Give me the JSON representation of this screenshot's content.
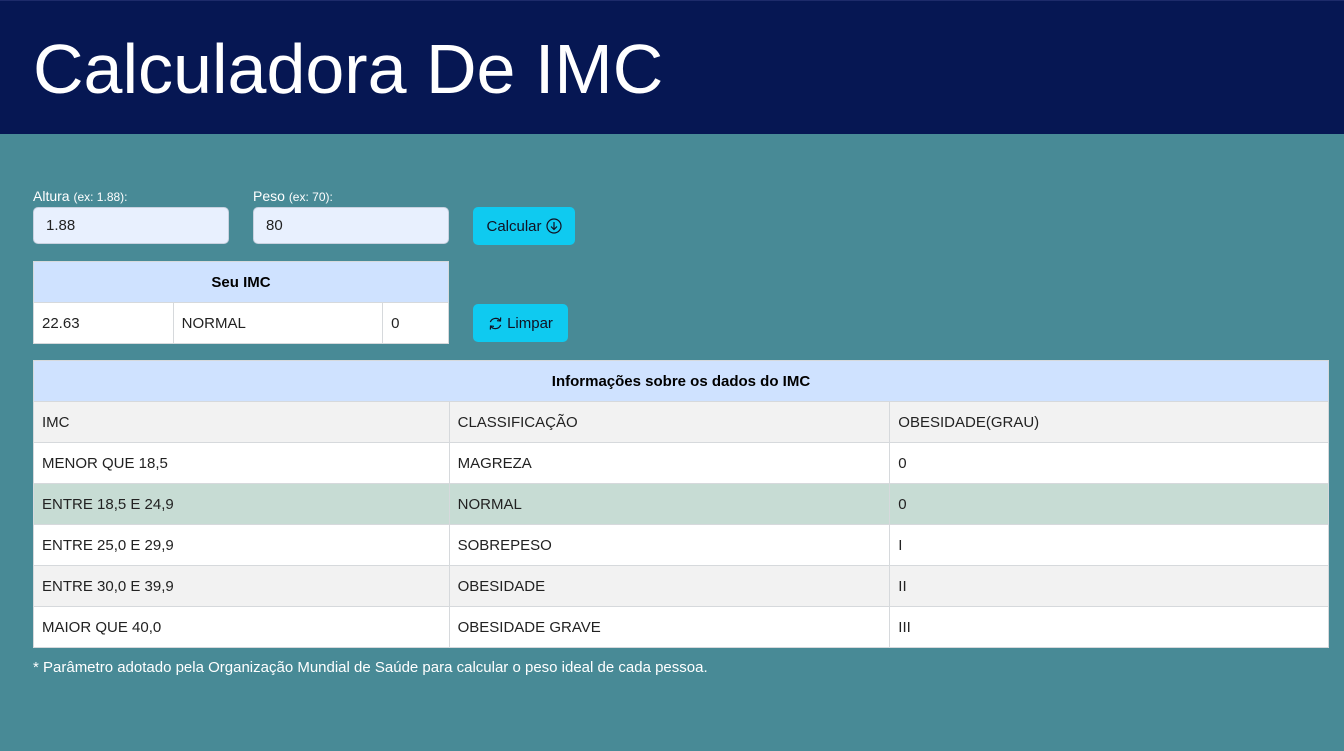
{
  "header": {
    "title": "Calculadora De IMC"
  },
  "form": {
    "altura": {
      "label": "Altura",
      "hint": "(ex: 1.88):",
      "value": "1.88"
    },
    "peso": {
      "label": "Peso",
      "hint": "(ex: 70):",
      "value": "80"
    },
    "calcular_label": "Calcular",
    "limpar_label": "Limpar"
  },
  "result": {
    "title": "Seu IMC",
    "imc": "22.63",
    "classificacao": "NORMAL",
    "grau": "0"
  },
  "info_table": {
    "title": "Informações sobre os dados do IMC",
    "headers": [
      "IMC",
      "CLASSIFICAÇÃO",
      "OBESIDADE(GRAU)"
    ],
    "rows": [
      [
        "MENOR QUE 18,5",
        "MAGREZA",
        "0"
      ],
      [
        "ENTRE 18,5 E 24,9",
        "NORMAL",
        "0"
      ],
      [
        "ENTRE 25,0 E 29,9",
        "SOBREPESO",
        "I"
      ],
      [
        "ENTRE 30,0 E 39,9",
        "OBESIDADE",
        "II"
      ],
      [
        "MAIOR QUE 40,0",
        "OBESIDADE GRAVE",
        "III"
      ]
    ]
  },
  "footnote": "* Parâmetro adotado pela Organização Mundial de Saúde para calcular o peso ideal de cada pessoa.",
  "colors": {
    "header_bg": "#061753",
    "page_bg": "#488a96",
    "button_bg": "#0fcaf0",
    "table_title_bg": "#cfe2ff",
    "highlight_row_bg": "#c7dcd4"
  },
  "icons": {
    "calcular": "arrow-down-circle-icon",
    "limpar": "refresh-icon"
  }
}
